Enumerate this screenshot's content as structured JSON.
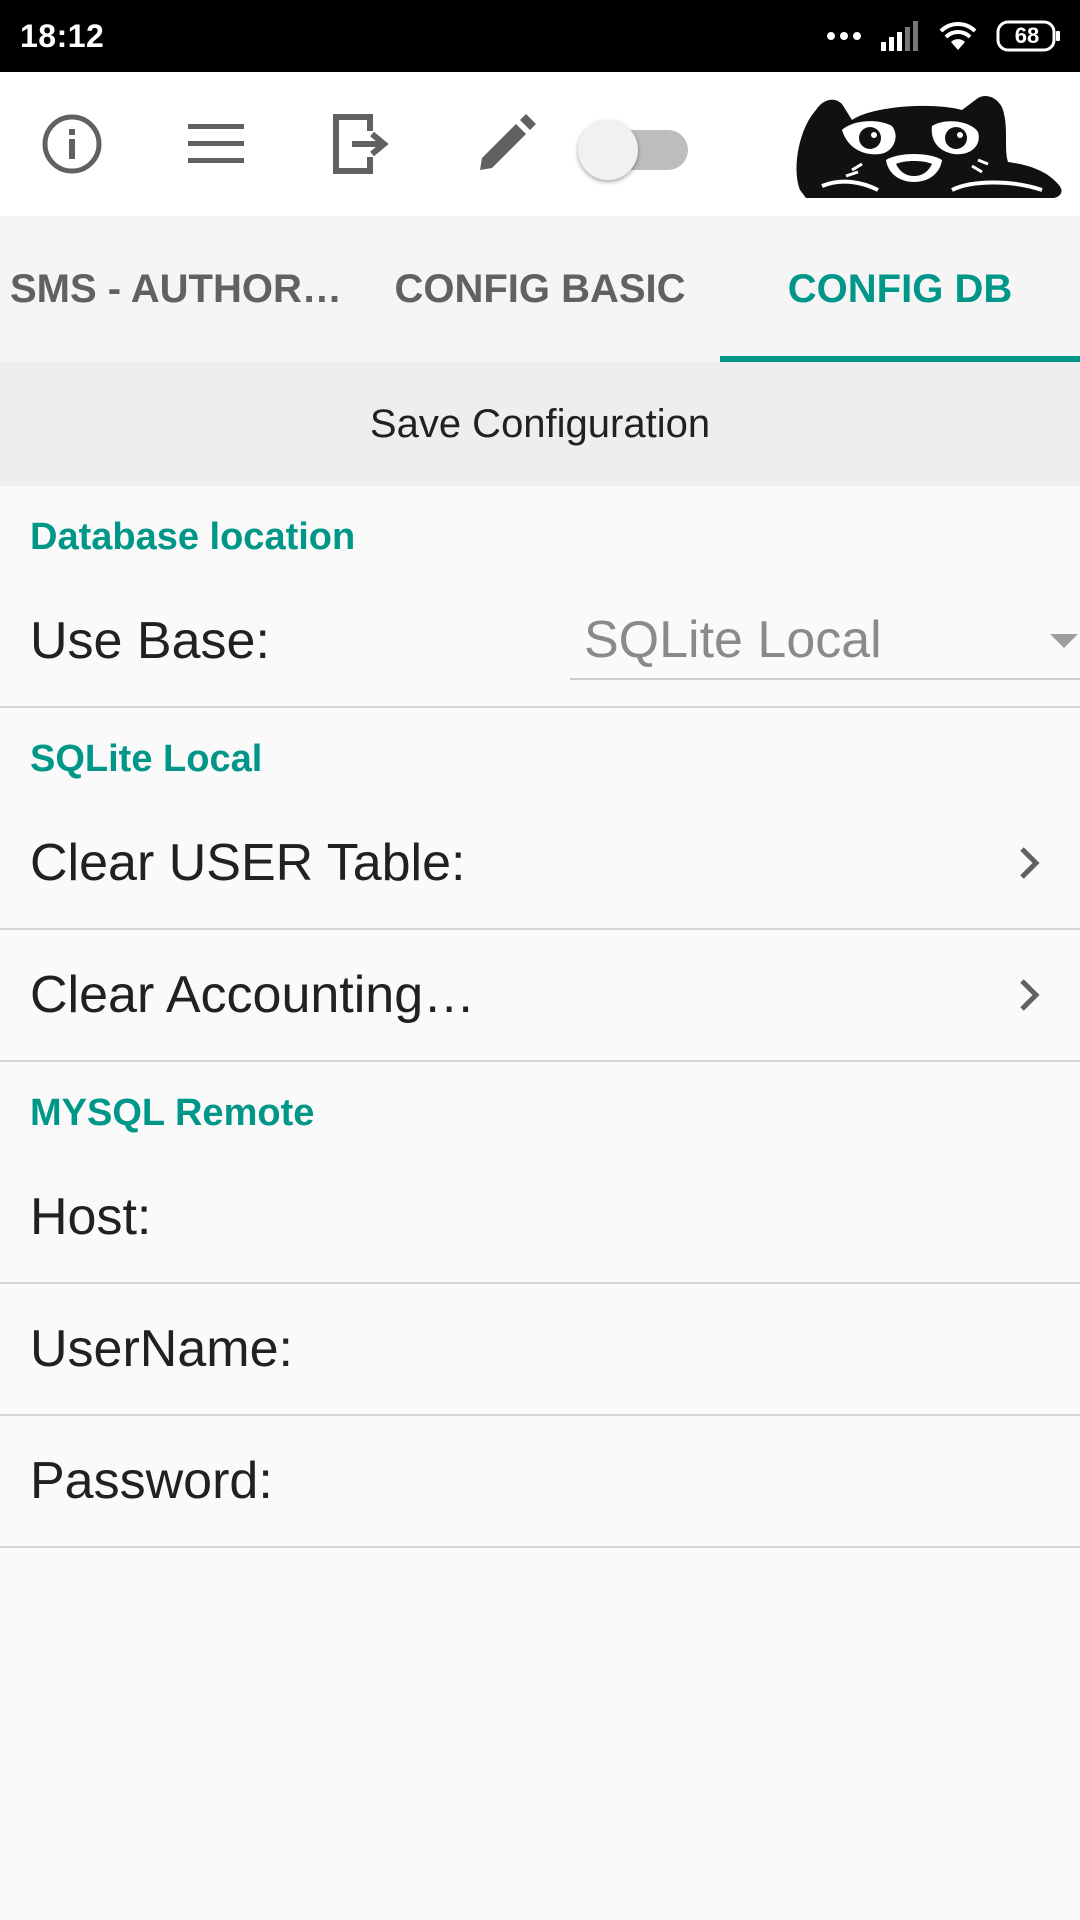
{
  "status_bar": {
    "time": "18:12",
    "battery": "68",
    "icons": [
      "more-dots-icon",
      "signal-icon",
      "wifi-icon",
      "battery-icon"
    ]
  },
  "toolbar": {
    "icons": [
      "info-icon",
      "menu-icon",
      "exit-icon",
      "edit-icon"
    ],
    "switch_on": false,
    "logo": "pug-logo"
  },
  "tabs": [
    {
      "label": "SMS - AUTHORIZATION",
      "active": false
    },
    {
      "label": "CONFIG BASIC",
      "active": false
    },
    {
      "label": "CONFIG DB",
      "active": true
    }
  ],
  "save_button": "Save Configuration",
  "sections": {
    "database_location": {
      "title": "Database location",
      "use_base_label": "Use Base:",
      "use_base_value": "SQLite Local"
    },
    "sqlite_local": {
      "title": "SQLite Local",
      "clear_user_table": "Clear USER Table:",
      "clear_accounting": "Clear Accounting…"
    },
    "mysql_remote": {
      "title": "MYSQL Remote",
      "host": "Host:",
      "username": "UserName:",
      "password": "Password:"
    }
  },
  "colors": {
    "accent": "#009688",
    "status_bar": "#000000",
    "tab_bg": "#f5f5f5",
    "save_bg": "#eeeeee"
  }
}
